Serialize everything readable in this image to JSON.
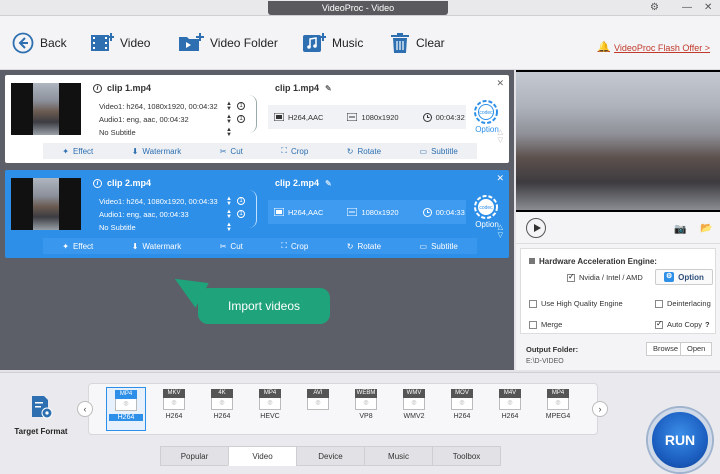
{
  "window": {
    "title": "VideoProc - Video"
  },
  "toolbar": {
    "back": "Back",
    "video": "Video",
    "video_folder": "Video Folder",
    "music": "Music",
    "clear": "Clear",
    "flash_offer": "VideoProc Flash Offer >"
  },
  "clips": [
    {
      "name": "clip 1.mp4",
      "video": "Video1: h264, 1080x1920, 00:04:32",
      "audio": "Audio1: eng, aac, 00:04:32",
      "subtitle": "No Subtitle",
      "video_count": "1",
      "audio_count": "1",
      "out_name": "clip 1.mp4",
      "codec": "H264,AAC",
      "resolution": "1080x1920",
      "duration": "00:04:32",
      "option": "Option",
      "codec_icon_text": "codec",
      "selected": false
    },
    {
      "name": "clip 2.mp4",
      "video": "Video1: h264, 1080x1920, 00:04:33",
      "audio": "Audio1: eng, aac, 00:04:33",
      "subtitle": "No Subtitle",
      "video_count": "1",
      "audio_count": "1",
      "out_name": "clip 2.mp4",
      "codec": "H264,AAC",
      "resolution": "1080x1920",
      "duration": "00:04:33",
      "option": "Option",
      "codec_icon_text": "codec",
      "selected": true
    }
  ],
  "edit_actions": [
    "Effect",
    "Watermark",
    "Cut",
    "Crop",
    "Rotate",
    "Subtitle"
  ],
  "callout": "Import videos",
  "settings": {
    "hw_title": "Hardware Acceleration Engine:",
    "nvidia": "Nvidia / Intel / AMD",
    "option_button": "Option",
    "high_quality": "Use High Quality Engine",
    "deinterlacing": "Deinterlacing",
    "merge": "Merge",
    "auto_copy": "Auto Copy",
    "auto_copy_help": "?",
    "output_folder_label": "Output Folder:",
    "output_path": "E:\\D-VIDEO",
    "browse": "Browse",
    "open": "Open"
  },
  "bottom": {
    "target_format": "Target Format",
    "formats": [
      {
        "top": "MP4",
        "sub": "H264",
        "selected": true
      },
      {
        "top": "MKV",
        "sub": "H264",
        "selected": false
      },
      {
        "top": "4K",
        "sub": "H264",
        "selected": false
      },
      {
        "top": "MP4",
        "sub": "HEVC",
        "selected": false
      },
      {
        "top": "AVI",
        "sub": "",
        "selected": false
      },
      {
        "top": "WEBM",
        "sub": "VP8",
        "selected": false
      },
      {
        "top": "WMV",
        "sub": "WMV2",
        "selected": false
      },
      {
        "top": "MOV",
        "sub": "H264",
        "selected": false
      },
      {
        "top": "M4V",
        "sub": "H264",
        "selected": false
      },
      {
        "top": "MP4",
        "sub": "MPEG4",
        "selected": false
      }
    ],
    "tabs": [
      "Popular",
      "Video",
      "Device",
      "Music",
      "Toolbox"
    ],
    "active_tab": "Video",
    "run": "RUN"
  }
}
